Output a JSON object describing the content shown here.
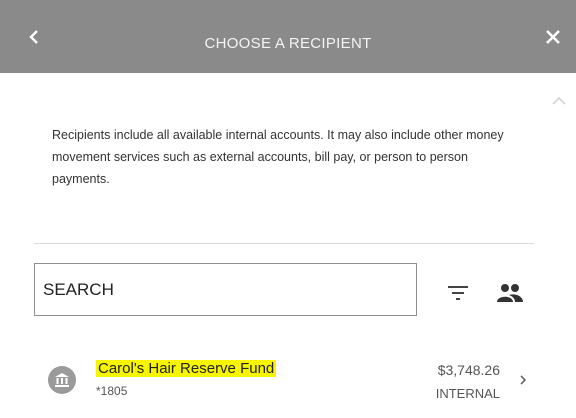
{
  "header": {
    "title": "CHOOSE A RECIPIENT",
    "back_icon": "chevron-left-icon",
    "close_icon": "close-icon",
    "background": "#8a8a8a"
  },
  "intro_text": "Recipients include all available internal accounts. It may also include other money movement services such as external accounts, bill pay, or person to person payments.",
  "search": {
    "placeholder": "SEARCH",
    "value": ""
  },
  "toolbar": {
    "filter_icon": "filter-icon",
    "contacts_icon": "contacts-icon"
  },
  "recipients": [
    {
      "name": "Carol's Hair Reserve Fund",
      "number": "*1805",
      "amount": "$3,748.26",
      "type": "INTERNAL",
      "icon": "bank-icon",
      "highlight": "#f7f400"
    }
  ]
}
